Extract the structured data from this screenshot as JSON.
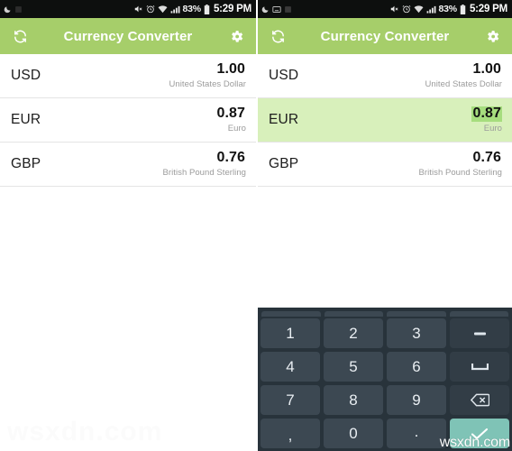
{
  "status_bar": {
    "icons_left": [
      "moon-icon",
      "sd-card-icon",
      "keyboard-icon"
    ],
    "icons_right": [
      "mute-icon",
      "alarm-icon",
      "wifi-icon",
      "signal-icon",
      "battery-icon"
    ],
    "battery_percent": "83%",
    "time": "5:29 PM"
  },
  "app_bar": {
    "title": "Currency Converter",
    "refresh_icon": "refresh-icon",
    "settings_icon": "gear-icon"
  },
  "currencies": [
    {
      "code": "USD",
      "value": "1.00",
      "name": "United States Dollar",
      "selected": false
    },
    {
      "code": "EUR",
      "value": "0.87",
      "name": "Euro",
      "selected": false
    },
    {
      "code": "GBP",
      "value": "0.76",
      "name": "British Pound Sterling",
      "selected": false
    }
  ],
  "currencies_right": [
    {
      "code": "USD",
      "value": "1.00",
      "name": "United States Dollar",
      "selected": false
    },
    {
      "code": "EUR",
      "value": "0.87",
      "name": "Euro",
      "selected": true
    },
    {
      "code": "GBP",
      "value": "0.76",
      "name": "British Pound Sterling",
      "selected": false
    }
  ],
  "keyboard": {
    "rows": [
      [
        {
          "label": "1",
          "name": "key-1",
          "type": "digit"
        },
        {
          "label": "2",
          "name": "key-2",
          "type": "digit"
        },
        {
          "label": "3",
          "name": "key-3",
          "type": "digit"
        },
        {
          "label": "–",
          "name": "key-minus",
          "type": "func"
        }
      ],
      [
        {
          "label": "4",
          "name": "key-4",
          "type": "digit"
        },
        {
          "label": "5",
          "name": "key-5",
          "type": "digit"
        },
        {
          "label": "6",
          "name": "key-6",
          "type": "digit"
        },
        {
          "label": "⌴",
          "name": "key-space",
          "type": "func-space"
        }
      ],
      [
        {
          "label": "7",
          "name": "key-7",
          "type": "digit"
        },
        {
          "label": "8",
          "name": "key-8",
          "type": "digit"
        },
        {
          "label": "9",
          "name": "key-9",
          "type": "digit"
        },
        {
          "label": "⌫",
          "name": "key-backspace",
          "type": "func-backspace"
        }
      ],
      [
        {
          "label": ",",
          "name": "key-comma",
          "type": "comma"
        },
        {
          "label": "0",
          "name": "key-0",
          "type": "digit"
        },
        {
          "label": ".",
          "name": "key-period",
          "type": "dot"
        },
        {
          "label": "✓",
          "name": "key-enter",
          "type": "enter"
        }
      ]
    ]
  },
  "watermark": {
    "left_text": "wsxdn.com",
    "right_text": "wsxdn.com"
  },
  "colors": {
    "app_bar_green": "#a6ce6a",
    "row_highlight": "#d8f0bb",
    "value_selection": "#a6dd7e",
    "keyboard_bg": "#28333b",
    "key_bg": "#3c4852",
    "enter_key": "#7fc3b6",
    "status_bar": "#0d0f0e"
  }
}
